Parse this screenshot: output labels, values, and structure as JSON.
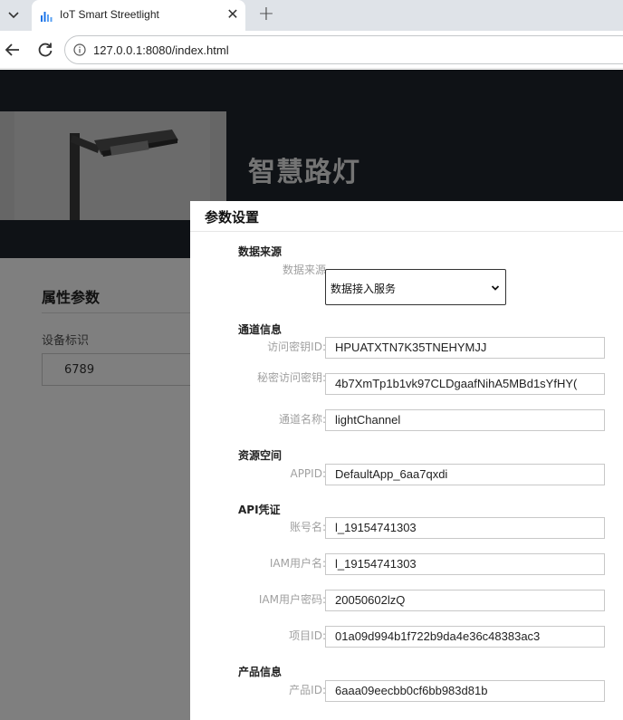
{
  "browser": {
    "tab_title": "IoT Smart Streetlight",
    "url": "127.0.0.1:8080/index.html"
  },
  "page": {
    "title": "智慧路灯",
    "section_title": "属性参数",
    "device_label": "设备标识",
    "device_value": "6789"
  },
  "dialog": {
    "title": "参数设置",
    "data_source": {
      "heading": "数据来源",
      "label": "数据来源",
      "selected": "数据接入服务"
    },
    "channel": {
      "heading": "通道信息",
      "access_key_label": "访问密钥ID:",
      "access_key": "HPUATXTN7K35TNEHYMJJ",
      "secret_key_label": "秘密访问密钥:",
      "secret_key": "4b7XmTp1b1vk97CLDgaafNihA5MBd1sYfHY(",
      "channel_name_label": "通道名称:",
      "channel_name": "lightChannel"
    },
    "resource": {
      "heading": "资源空间",
      "appid_label": "APPID:",
      "appid": "DefaultApp_6aa7qxdi"
    },
    "api": {
      "heading": "API凭证",
      "account_label": "账号名:",
      "account": "l_19154741303",
      "iam_user_label": "IAM用户名:",
      "iam_user": "l_19154741303",
      "iam_password_label": "IAM用户密码:",
      "iam_password": "20050602lzQ",
      "project_id_label": "项目ID:",
      "project_id": "01a09d994b1f722b9da4e36c48383ac3"
    },
    "product": {
      "heading": "产品信息",
      "product_id_label": "产品ID:",
      "product_id": "6aaa09eecbb0cf6bb983d81b"
    }
  },
  "colors": {
    "header_bg": "#1e242c",
    "overlay": "rgba(0,0,0,0.5)",
    "label_gray": "#a0a0a0"
  }
}
